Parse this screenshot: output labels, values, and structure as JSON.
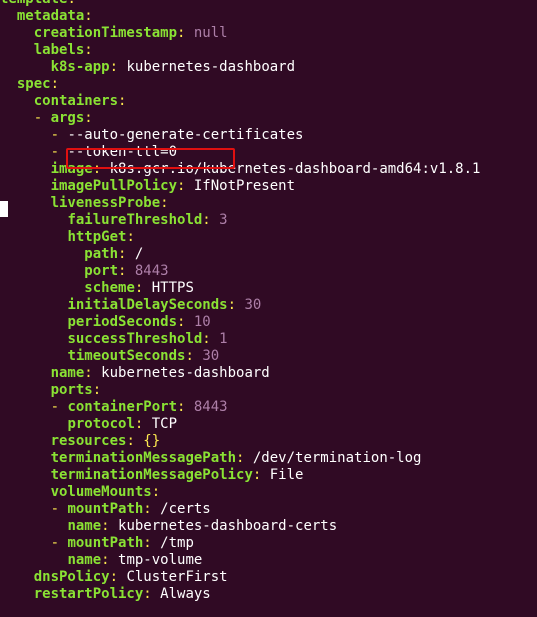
{
  "terminal": {
    "lines": [
      {
        "indent": "",
        "dash": "",
        "key": "template",
        "colon": ":",
        "value": "",
        "vclass": "s"
      },
      {
        "indent": "  ",
        "dash": "",
        "key": "metadata",
        "colon": ":",
        "value": "",
        "vclass": "s"
      },
      {
        "indent": "    ",
        "dash": "",
        "key": "creationTimestamp",
        "colon": ":",
        "value": " null",
        "vclass": "n"
      },
      {
        "indent": "    ",
        "dash": "",
        "key": "labels",
        "colon": ":",
        "value": "",
        "vclass": "s"
      },
      {
        "indent": "      ",
        "dash": "",
        "key": "k8s-app",
        "colon": ":",
        "value": " kubernetes-dashboard",
        "vclass": "s"
      },
      {
        "indent": "  ",
        "dash": "",
        "key": "spec",
        "colon": ":",
        "value": "",
        "vclass": "s"
      },
      {
        "indent": "    ",
        "dash": "",
        "key": "containers",
        "colon": ":",
        "value": "",
        "vclass": "s"
      },
      {
        "indent": "    ",
        "dash": "- ",
        "key": "args",
        "colon": ":",
        "value": "",
        "vclass": "s"
      },
      {
        "indent": "      ",
        "dash": "- ",
        "key": "",
        "colon": "",
        "value": "--auto-generate-certificates",
        "vclass": "s"
      },
      {
        "indent": "      ",
        "dash": "- ",
        "key": "",
        "colon": "",
        "value": "--token-ttl=0",
        "vclass": "s"
      },
      {
        "indent": "      ",
        "dash": "",
        "key": "image",
        "colon": ":",
        "value": " k8s.gcr.io/kubernetes-dashboard-amd64:v1.8.1",
        "vclass": "s"
      },
      {
        "indent": "      ",
        "dash": "",
        "key": "imagePullPolicy",
        "colon": ":",
        "value": " IfNotPresent",
        "vclass": "s"
      },
      {
        "indent": "      ",
        "dash": "",
        "key": "livenessProbe",
        "colon": ":",
        "value": "",
        "vclass": "s"
      },
      {
        "indent": "        ",
        "dash": "",
        "key": "failureThreshold",
        "colon": ":",
        "value": " 3",
        "vclass": "n"
      },
      {
        "indent": "        ",
        "dash": "",
        "key": "httpGet",
        "colon": ":",
        "value": "",
        "vclass": "s"
      },
      {
        "indent": "          ",
        "dash": "",
        "key": "path",
        "colon": ":",
        "value": " /",
        "vclass": "s"
      },
      {
        "indent": "          ",
        "dash": "",
        "key": "port",
        "colon": ":",
        "value": " 8443",
        "vclass": "n"
      },
      {
        "indent": "          ",
        "dash": "",
        "key": "scheme",
        "colon": ":",
        "value": " HTTPS",
        "vclass": "s"
      },
      {
        "indent": "        ",
        "dash": "",
        "key": "initialDelaySeconds",
        "colon": ":",
        "value": " 30",
        "vclass": "n"
      },
      {
        "indent": "        ",
        "dash": "",
        "key": "periodSeconds",
        "colon": ":",
        "value": " 10",
        "vclass": "n"
      },
      {
        "indent": "        ",
        "dash": "",
        "key": "successThreshold",
        "colon": ":",
        "value": " 1",
        "vclass": "n"
      },
      {
        "indent": "        ",
        "dash": "",
        "key": "timeoutSeconds",
        "colon": ":",
        "value": " 30",
        "vclass": "n"
      },
      {
        "indent": "      ",
        "dash": "",
        "key": "name",
        "colon": ":",
        "value": " kubernetes-dashboard",
        "vclass": "s"
      },
      {
        "indent": "      ",
        "dash": "",
        "key": "ports",
        "colon": ":",
        "value": "",
        "vclass": "s"
      },
      {
        "indent": "      ",
        "dash": "- ",
        "key": "containerPort",
        "colon": ":",
        "value": " 8443",
        "vclass": "n"
      },
      {
        "indent": "        ",
        "dash": "",
        "key": "protocol",
        "colon": ":",
        "value": " TCP",
        "vclass": "s"
      },
      {
        "indent": "      ",
        "dash": "",
        "key": "resources",
        "colon": ":",
        "value": " {}",
        "vclass": "d"
      },
      {
        "indent": "      ",
        "dash": "",
        "key": "terminationMessagePath",
        "colon": ":",
        "value": " /dev/termination-log",
        "vclass": "s"
      },
      {
        "indent": "      ",
        "dash": "",
        "key": "terminationMessagePolicy",
        "colon": ":",
        "value": " File",
        "vclass": "s"
      },
      {
        "indent": "      ",
        "dash": "",
        "key": "volumeMounts",
        "colon": ":",
        "value": "",
        "vclass": "s"
      },
      {
        "indent": "      ",
        "dash": "- ",
        "key": "mountPath",
        "colon": ":",
        "value": " /certs",
        "vclass": "s"
      },
      {
        "indent": "        ",
        "dash": "",
        "key": "name",
        "colon": ":",
        "value": " kubernetes-dashboard-certs",
        "vclass": "s"
      },
      {
        "indent": "      ",
        "dash": "- ",
        "key": "mountPath",
        "colon": ":",
        "value": " /tmp",
        "vclass": "s"
      },
      {
        "indent": "        ",
        "dash": "",
        "key": "name",
        "colon": ":",
        "value": " tmp-volume",
        "vclass": "s"
      },
      {
        "indent": "    ",
        "dash": "",
        "key": "dnsPolicy",
        "colon": ":",
        "value": " ClusterFirst",
        "vclass": "s"
      },
      {
        "indent": "    ",
        "dash": "",
        "key": "restartPolicy",
        "colon": ":",
        "value": " Always",
        "vclass": "s"
      }
    ]
  },
  "colors": {
    "background": "#300a24",
    "key": "#8ae234",
    "dash_and_colon": "#fce94f",
    "number": "#ad7fa8",
    "text": "#ffffff",
    "highlight_box": "#e01010"
  }
}
